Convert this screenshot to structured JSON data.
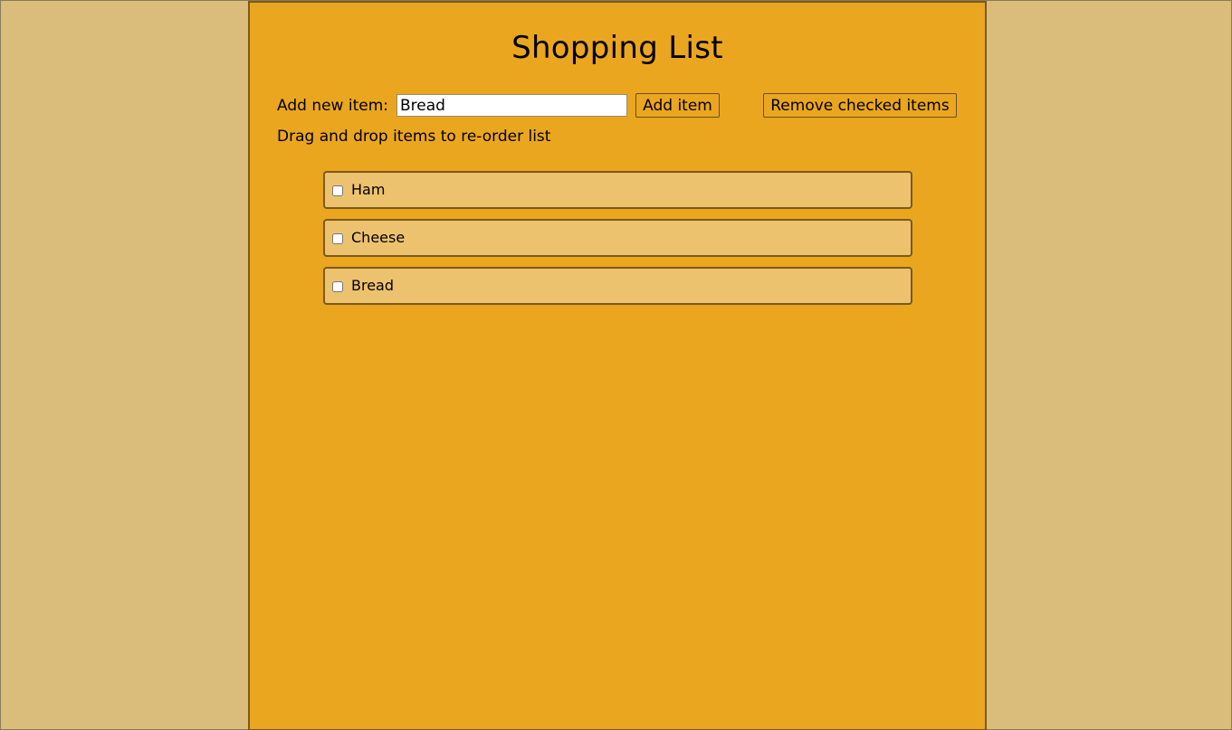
{
  "title": "Shopping List",
  "add": {
    "label": "Add new item:",
    "input_value": "Bread",
    "add_button": "Add item",
    "remove_button": "Remove checked items"
  },
  "hint": "Drag and drop items to re-order list",
  "items": [
    {
      "label": "Ham",
      "checked": false
    },
    {
      "label": "Cheese",
      "checked": false
    },
    {
      "label": "Bread",
      "checked": false
    }
  ],
  "colors": {
    "page_background": "#dabd7b",
    "panel_background": "#eaa61f",
    "item_background": "#edc26f",
    "border": "#7a5a1c"
  }
}
